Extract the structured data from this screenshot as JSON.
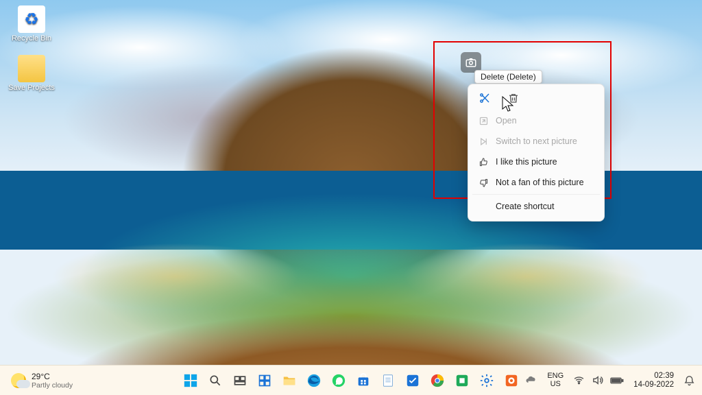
{
  "desktop": {
    "icons": {
      "recycle_bin": "Recycle Bin",
      "save_projects": "Save Projects"
    }
  },
  "tooltip": {
    "delete": "Delete (Delete)"
  },
  "context_menu": {
    "open": "Open",
    "next_picture": "Switch to next picture",
    "like": "I like this picture",
    "dislike": "Not a fan of this picture",
    "create_shortcut": "Create shortcut"
  },
  "taskbar": {
    "weather": {
      "temp": "29°C",
      "cond": "Partly cloudy"
    },
    "lang": {
      "top": "ENG",
      "bottom": "US"
    },
    "clock": {
      "time": "02:39",
      "date": "14-09-2022"
    }
  }
}
